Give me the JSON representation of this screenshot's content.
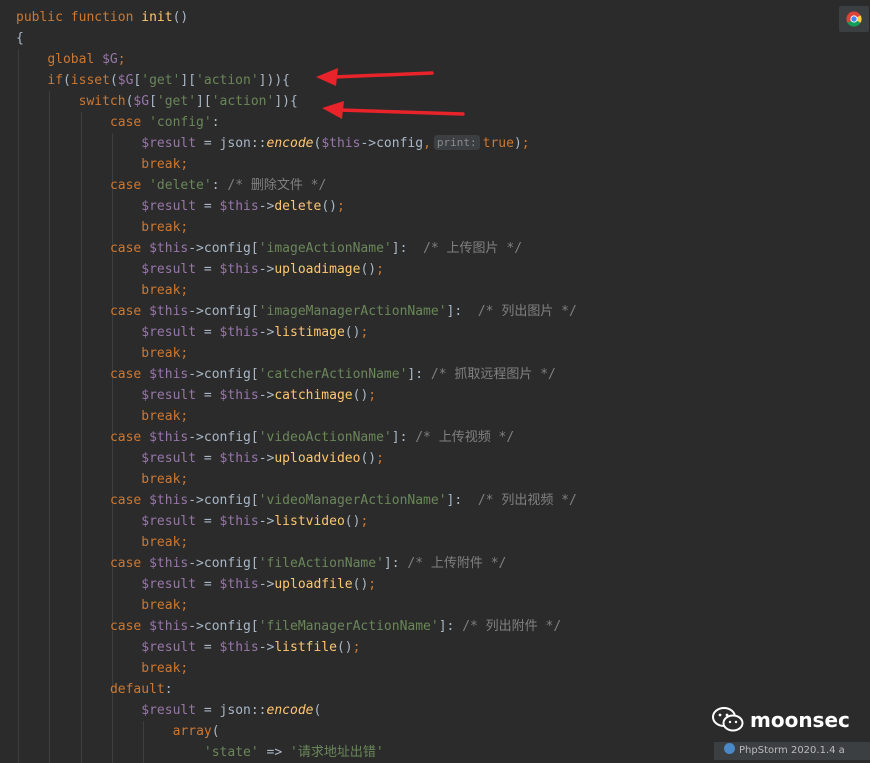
{
  "colors": {
    "background": "#2b2b2b",
    "keyword": "#cc7832",
    "function": "#ffc66d",
    "variable": "#9876aa",
    "string": "#6a8759",
    "comment": "#808080",
    "plain": "#a9b7c6",
    "annotation_arrow": "#e8232a"
  },
  "code": [
    {
      "indent": 0,
      "tokens": [
        [
          "kw",
          "public "
        ],
        [
          "kw",
          "function "
        ],
        [
          "fn",
          "init"
        ],
        [
          "p",
          "()"
        ]
      ]
    },
    {
      "indent": 0,
      "tokens": [
        [
          "p",
          "{"
        ]
      ]
    },
    {
      "indent": 1,
      "tokens": [
        [
          "kw",
          "global "
        ],
        [
          "var",
          "$G"
        ],
        [
          "kw",
          ";"
        ]
      ]
    },
    {
      "indent": 1,
      "tokens": [
        [
          "kw",
          "if"
        ],
        [
          "p",
          "("
        ],
        [
          "kw",
          "isset"
        ],
        [
          "p",
          "("
        ],
        [
          "var",
          "$G"
        ],
        [
          "p",
          "["
        ],
        [
          "str",
          "'get'"
        ],
        [
          "p",
          "]["
        ],
        [
          "str",
          "'action'"
        ],
        [
          "p",
          "])){"
        ]
      ]
    },
    {
      "indent": 2,
      "tokens": [
        [
          "kw",
          "switch"
        ],
        [
          "p",
          "("
        ],
        [
          "var",
          "$G"
        ],
        [
          "p",
          "["
        ],
        [
          "str",
          "'get'"
        ],
        [
          "p",
          "]["
        ],
        [
          "str",
          "'action'"
        ],
        [
          "p",
          "]){"
        ]
      ]
    },
    {
      "indent": 3,
      "tokens": [
        [
          "kw",
          "case "
        ],
        [
          "str",
          "'config'"
        ],
        [
          "p",
          ":"
        ]
      ]
    },
    {
      "indent": 4,
      "tokens": [
        [
          "var",
          "$result"
        ],
        [
          "p",
          " = json::"
        ],
        [
          "fnit",
          "encode"
        ],
        [
          "p",
          "("
        ],
        [
          "var",
          "$this"
        ],
        [
          "p",
          "->config"
        ],
        [
          "kw",
          ","
        ],
        [
          "hint",
          "print:"
        ],
        [
          "kw",
          "true"
        ],
        [
          "p",
          ")"
        ],
        [
          "kw",
          ";"
        ]
      ]
    },
    {
      "indent": 4,
      "tokens": [
        [
          "kw",
          "break;"
        ]
      ]
    },
    {
      "indent": 3,
      "tokens": [
        [
          "kw",
          "case "
        ],
        [
          "str",
          "'delete'"
        ],
        [
          "p",
          ": "
        ],
        [
          "cmt",
          "/* 删除文件 */"
        ]
      ]
    },
    {
      "indent": 4,
      "tokens": [
        [
          "var",
          "$result"
        ],
        [
          "p",
          " = "
        ],
        [
          "var",
          "$this"
        ],
        [
          "p",
          "->"
        ],
        [
          "fn",
          "delete"
        ],
        [
          "p",
          "()"
        ],
        [
          "kw",
          ";"
        ]
      ]
    },
    {
      "indent": 4,
      "tokens": [
        [
          "kw",
          "break;"
        ]
      ]
    },
    {
      "indent": 3,
      "tokens": [
        [
          "kw",
          "case "
        ],
        [
          "var",
          "$this"
        ],
        [
          "p",
          "->config["
        ],
        [
          "str",
          "'imageActionName'"
        ],
        [
          "p",
          "]:  "
        ],
        [
          "cmt",
          "/* 上传图片 */"
        ]
      ]
    },
    {
      "indent": 4,
      "tokens": [
        [
          "var",
          "$result"
        ],
        [
          "p",
          " = "
        ],
        [
          "var",
          "$this"
        ],
        [
          "p",
          "->"
        ],
        [
          "fn",
          "uploadimage"
        ],
        [
          "p",
          "()"
        ],
        [
          "kw",
          ";"
        ]
      ]
    },
    {
      "indent": 4,
      "tokens": [
        [
          "kw",
          "break;"
        ]
      ]
    },
    {
      "indent": 3,
      "tokens": [
        [
          "kw",
          "case "
        ],
        [
          "var",
          "$this"
        ],
        [
          "p",
          "->config["
        ],
        [
          "str",
          "'imageManagerActionName'"
        ],
        [
          "p",
          "]:  "
        ],
        [
          "cmt",
          "/* 列出图片 */"
        ]
      ]
    },
    {
      "indent": 4,
      "tokens": [
        [
          "var",
          "$result"
        ],
        [
          "p",
          " = "
        ],
        [
          "var",
          "$this"
        ],
        [
          "p",
          "->"
        ],
        [
          "fn",
          "listimage"
        ],
        [
          "p",
          "()"
        ],
        [
          "kw",
          ";"
        ]
      ]
    },
    {
      "indent": 4,
      "tokens": [
        [
          "kw",
          "break;"
        ]
      ]
    },
    {
      "indent": 3,
      "tokens": [
        [
          "kw",
          "case "
        ],
        [
          "var",
          "$this"
        ],
        [
          "p",
          "->config["
        ],
        [
          "str",
          "'catcherActionName'"
        ],
        [
          "p",
          "]: "
        ],
        [
          "cmt",
          "/* 抓取远程图片 */"
        ]
      ]
    },
    {
      "indent": 4,
      "tokens": [
        [
          "var",
          "$result"
        ],
        [
          "p",
          " = "
        ],
        [
          "var",
          "$this"
        ],
        [
          "p",
          "->"
        ],
        [
          "fn",
          "catchimage"
        ],
        [
          "p",
          "()"
        ],
        [
          "kw",
          ";"
        ]
      ]
    },
    {
      "indent": 4,
      "tokens": [
        [
          "kw",
          "break;"
        ]
      ]
    },
    {
      "indent": 3,
      "tokens": [
        [
          "kw",
          "case "
        ],
        [
          "var",
          "$this"
        ],
        [
          "p",
          "->config["
        ],
        [
          "str",
          "'videoActionName'"
        ],
        [
          "p",
          "]: "
        ],
        [
          "cmt",
          "/* 上传视频 */"
        ]
      ]
    },
    {
      "indent": 4,
      "tokens": [
        [
          "var",
          "$result"
        ],
        [
          "p",
          " = "
        ],
        [
          "var",
          "$this"
        ],
        [
          "p",
          "->"
        ],
        [
          "fn",
          "uploadvideo"
        ],
        [
          "p",
          "()"
        ],
        [
          "kw",
          ";"
        ]
      ]
    },
    {
      "indent": 4,
      "tokens": [
        [
          "kw",
          "break;"
        ]
      ]
    },
    {
      "indent": 3,
      "tokens": [
        [
          "kw",
          "case "
        ],
        [
          "var",
          "$this"
        ],
        [
          "p",
          "->config["
        ],
        [
          "str",
          "'videoManagerActionName'"
        ],
        [
          "p",
          "]:  "
        ],
        [
          "cmt",
          "/* 列出视频 */"
        ]
      ]
    },
    {
      "indent": 4,
      "tokens": [
        [
          "var",
          "$result"
        ],
        [
          "p",
          " = "
        ],
        [
          "var",
          "$this"
        ],
        [
          "p",
          "->"
        ],
        [
          "fn",
          "listvideo"
        ],
        [
          "p",
          "()"
        ],
        [
          "kw",
          ";"
        ]
      ]
    },
    {
      "indent": 4,
      "tokens": [
        [
          "kw",
          "break;"
        ]
      ]
    },
    {
      "indent": 3,
      "tokens": [
        [
          "kw",
          "case "
        ],
        [
          "var",
          "$this"
        ],
        [
          "p",
          "->config["
        ],
        [
          "str",
          "'fileActionName'"
        ],
        [
          "p",
          "]: "
        ],
        [
          "cmt",
          "/* 上传附件 */"
        ]
      ]
    },
    {
      "indent": 4,
      "tokens": [
        [
          "var",
          "$result"
        ],
        [
          "p",
          " = "
        ],
        [
          "var",
          "$this"
        ],
        [
          "p",
          "->"
        ],
        [
          "fn",
          "uploadfile"
        ],
        [
          "p",
          "()"
        ],
        [
          "kw",
          ";"
        ]
      ]
    },
    {
      "indent": 4,
      "tokens": [
        [
          "kw",
          "break;"
        ]
      ]
    },
    {
      "indent": 3,
      "tokens": [
        [
          "kw",
          "case "
        ],
        [
          "var",
          "$this"
        ],
        [
          "p",
          "->config["
        ],
        [
          "str",
          "'fileManagerActionName'"
        ],
        [
          "p",
          "]: "
        ],
        [
          "cmt",
          "/* 列出附件 */"
        ]
      ]
    },
    {
      "indent": 4,
      "tokens": [
        [
          "var",
          "$result"
        ],
        [
          "p",
          " = "
        ],
        [
          "var",
          "$this"
        ],
        [
          "p",
          "->"
        ],
        [
          "fn",
          "listfile"
        ],
        [
          "p",
          "()"
        ],
        [
          "kw",
          ";"
        ]
      ]
    },
    {
      "indent": 4,
      "tokens": [
        [
          "kw",
          "break;"
        ]
      ]
    },
    {
      "indent": 3,
      "tokens": [
        [
          "kw",
          "default"
        ],
        [
          "p",
          ":"
        ]
      ]
    },
    {
      "indent": 4,
      "tokens": [
        [
          "var",
          "$result"
        ],
        [
          "p",
          " = json::"
        ],
        [
          "fnit",
          "encode"
        ],
        [
          "p",
          "("
        ]
      ]
    },
    {
      "indent": 5,
      "tokens": [
        [
          "kw",
          "array"
        ],
        [
          "p",
          "("
        ]
      ]
    },
    {
      "indent": 6,
      "tokens": [
        [
          "str",
          "'state'"
        ],
        [
          "p",
          " => "
        ],
        [
          "str",
          "'请求地址出错'"
        ]
      ]
    }
  ],
  "watermark": {
    "text": "moonsec",
    "icon": "wechat-icon"
  },
  "statusbar": {
    "text": "PhpStorm 2020.1.4 a",
    "icon": "info-icon"
  },
  "browser_button": {
    "icon": "chrome-icon"
  }
}
